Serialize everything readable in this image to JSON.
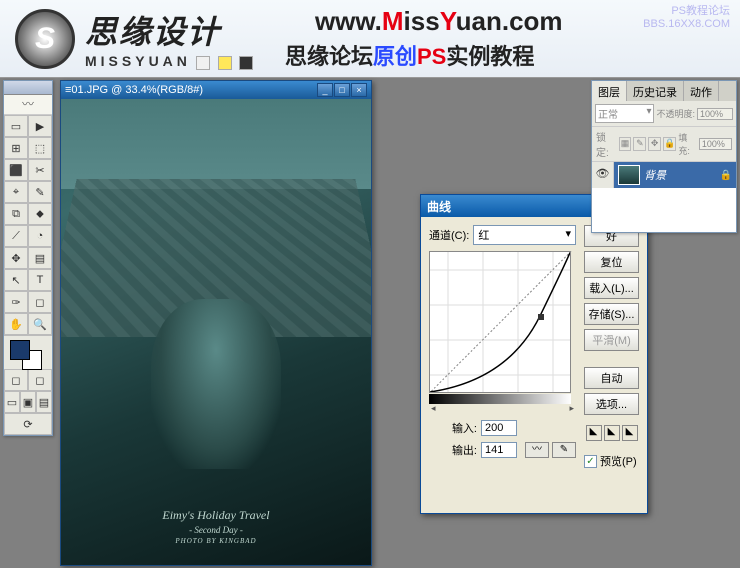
{
  "header": {
    "logo_glyph": "S",
    "logo_cn": "思缘设计",
    "logo_en": "MISSYUAN",
    "url": {
      "www": "www.",
      "m": "M",
      "iss": "iss",
      "y": "Y",
      "uan": "uan",
      "com": ".com"
    },
    "subtitle": {
      "a": "思缘论坛",
      "b": "原创",
      "c": "PS",
      "d": "实例教程"
    },
    "watermark1": "PS教程论坛",
    "watermark2": "BBS.16XX8.COM"
  },
  "toolbox": {
    "tools": [
      "▭",
      "▶",
      "⊞",
      "⬚",
      "⬛",
      "✂",
      "⌖",
      "✎",
      "⧉",
      "⬥",
      "⟋",
      "◔",
      "✥",
      "▤",
      "↖",
      "T",
      "✑",
      "◻",
      "✋",
      "🔍",
      "⟋",
      "⬤"
    ],
    "bottom_modes": [
      "◻",
      "◻"
    ],
    "screen_modes": [
      "▭",
      "▣",
      "▤"
    ],
    "jump": "⟳"
  },
  "doc": {
    "title": "01.JPG @ 33.4%(RGB/8#)",
    "icon": "≡",
    "caption_main": "Eimy's Holiday Travel",
    "caption_sub": "- Second Day -",
    "caption_small": "PHOTO BY KINGBAD"
  },
  "curves": {
    "title": "曲线",
    "channel_label": "通道(C):",
    "channel_value": "红",
    "input_label": "输入:",
    "input_value": "200",
    "output_label": "输出:",
    "output_value": "141",
    "btn_ok": "好",
    "btn_reset": "复位",
    "btn_load": "载入(L)...",
    "btn_save": "存储(S)...",
    "btn_smooth": "平滑(M)",
    "btn_auto": "自动",
    "btn_options": "选项...",
    "preview_label": "预览(P)",
    "curve_icon": "〰",
    "pencil_icon": "✎"
  },
  "layers": {
    "tab1": "图层",
    "tab2": "历史记录",
    "tab3": "动作",
    "blend_mode": "正常",
    "opacity_label": "不透明度:",
    "opacity_value": "100%",
    "lock_label": "锁定:",
    "fill_label": "填充:",
    "fill_value": "100%",
    "layer_name": "背景",
    "eye": "👁",
    "lock_icon": "🔒"
  }
}
